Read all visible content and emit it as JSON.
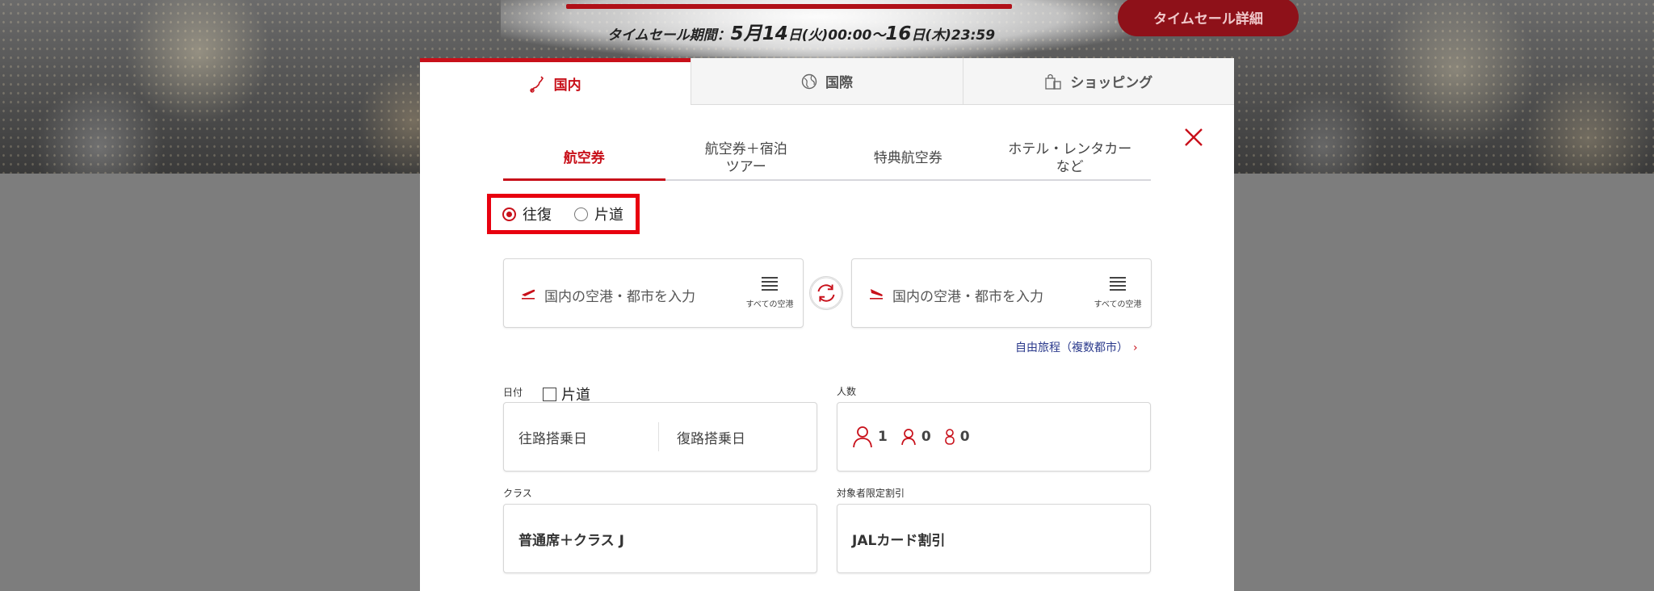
{
  "header": {
    "sale_period_prefix": "タイムセール期間：",
    "sale_start_month": "5月",
    "sale_start_day": "14",
    "sale_start_suffix": "日(火)00:00～",
    "sale_end_day": "16",
    "sale_end_suffix": "日(木)23:59",
    "sale_detail_button": "タイムセール詳細"
  },
  "top_tabs": [
    {
      "label": "国内",
      "icon": "japan-map-icon",
      "active": true
    },
    {
      "label": "国際",
      "icon": "globe-icon",
      "active": false
    },
    {
      "label": "ショッピング",
      "icon": "shopping-bag-icon",
      "active": false
    }
  ],
  "sub_tabs": [
    {
      "label": "航空券",
      "active": true
    },
    {
      "label_line1": "航空券＋宿泊",
      "label_line2": "ツアー",
      "active": false
    },
    {
      "label": "特典航空券",
      "active": false
    },
    {
      "label_line1": "ホテル・レンタカー",
      "label_line2": "など",
      "active": false
    }
  ],
  "trip_type": {
    "round_trip": "往復",
    "one_way": "片道",
    "selected": "往復"
  },
  "airports": {
    "from_placeholder": "国内の空港・都市を入力",
    "to_placeholder": "国内の空港・都市を入力",
    "all_airports_label": "すべての空港"
  },
  "multi_city_link": "自由旅程（複数都市）",
  "date": {
    "label": "日付",
    "one_way_checkbox": "片道",
    "outbound_placeholder": "往路搭乗日",
    "return_placeholder": "復路搭乗日"
  },
  "passengers": {
    "label": "人数",
    "adults": "1",
    "children": "0",
    "infants": "0"
  },
  "class": {
    "label": "クラス",
    "value": "普通席＋クラス J"
  },
  "discount": {
    "label": "対象者限定割引",
    "value": "JALカード割引"
  },
  "colors": {
    "brand_red": "#c8101a",
    "highlight_red": "#e8000f",
    "link_blue": "#2b3a8c"
  }
}
